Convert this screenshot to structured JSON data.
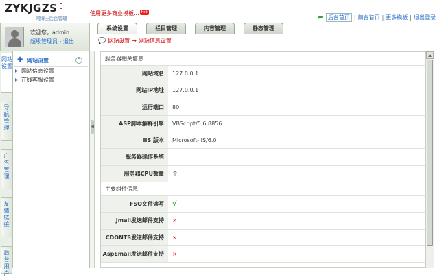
{
  "header": {
    "logo": "ZYKJGZS",
    "logo_sub": "网博士后台管理",
    "promo_text": "使用更多商业模板...",
    "promo_badge": "hot",
    "links": [
      "后台首页",
      "前台首页",
      "更多模板",
      "退出登录"
    ]
  },
  "user": {
    "welcome": "欢迎您，admin",
    "role": "超级管理员",
    "logout": "退出"
  },
  "tabs": [
    "系统设置",
    "栏目管理",
    "内容管理",
    "静态管理"
  ],
  "side_tabs": [
    "网站设置",
    "导航管理",
    "广告管理",
    "友情链接",
    "后台用户"
  ],
  "nav": {
    "title": "网站设置",
    "items": [
      "网站信息设置",
      "在线客服设置"
    ]
  },
  "breadcrumb": {
    "first": "网站设置",
    "arrow": "→",
    "second": "网站信息设置"
  },
  "sections": {
    "server": "服务器相关信息",
    "components": "主要组件信息"
  },
  "server_rows": [
    {
      "label": "网站域名",
      "value": "127.0.0.1"
    },
    {
      "label": "网站IP地址",
      "value": "127.0.0.1"
    },
    {
      "label": "运行端口",
      "value": "80"
    },
    {
      "label": "ASP脚本解释引擎",
      "value": "VBScript/5.6.8856"
    },
    {
      "label": "IIS 版本",
      "value": "Microsoft-IIS/6.0"
    },
    {
      "label": "服务器操作系统",
      "value": ""
    },
    {
      "label": "服务器CPU数量",
      "value": "个"
    }
  ],
  "component_rows": [
    {
      "label": "FSO文件读写",
      "value": "√"
    },
    {
      "label": "Jmail发送邮件支持",
      "value": "×"
    },
    {
      "label": "CDONTS发送邮件支持",
      "value": "×"
    },
    {
      "label": "AspEmail发送邮件支持",
      "value": "×"
    }
  ],
  "colors": {
    "accent": "#2a6cc6",
    "breadcrumb": "#cc0000",
    "ok": "#1a9a1a",
    "no": "#dd2222"
  }
}
